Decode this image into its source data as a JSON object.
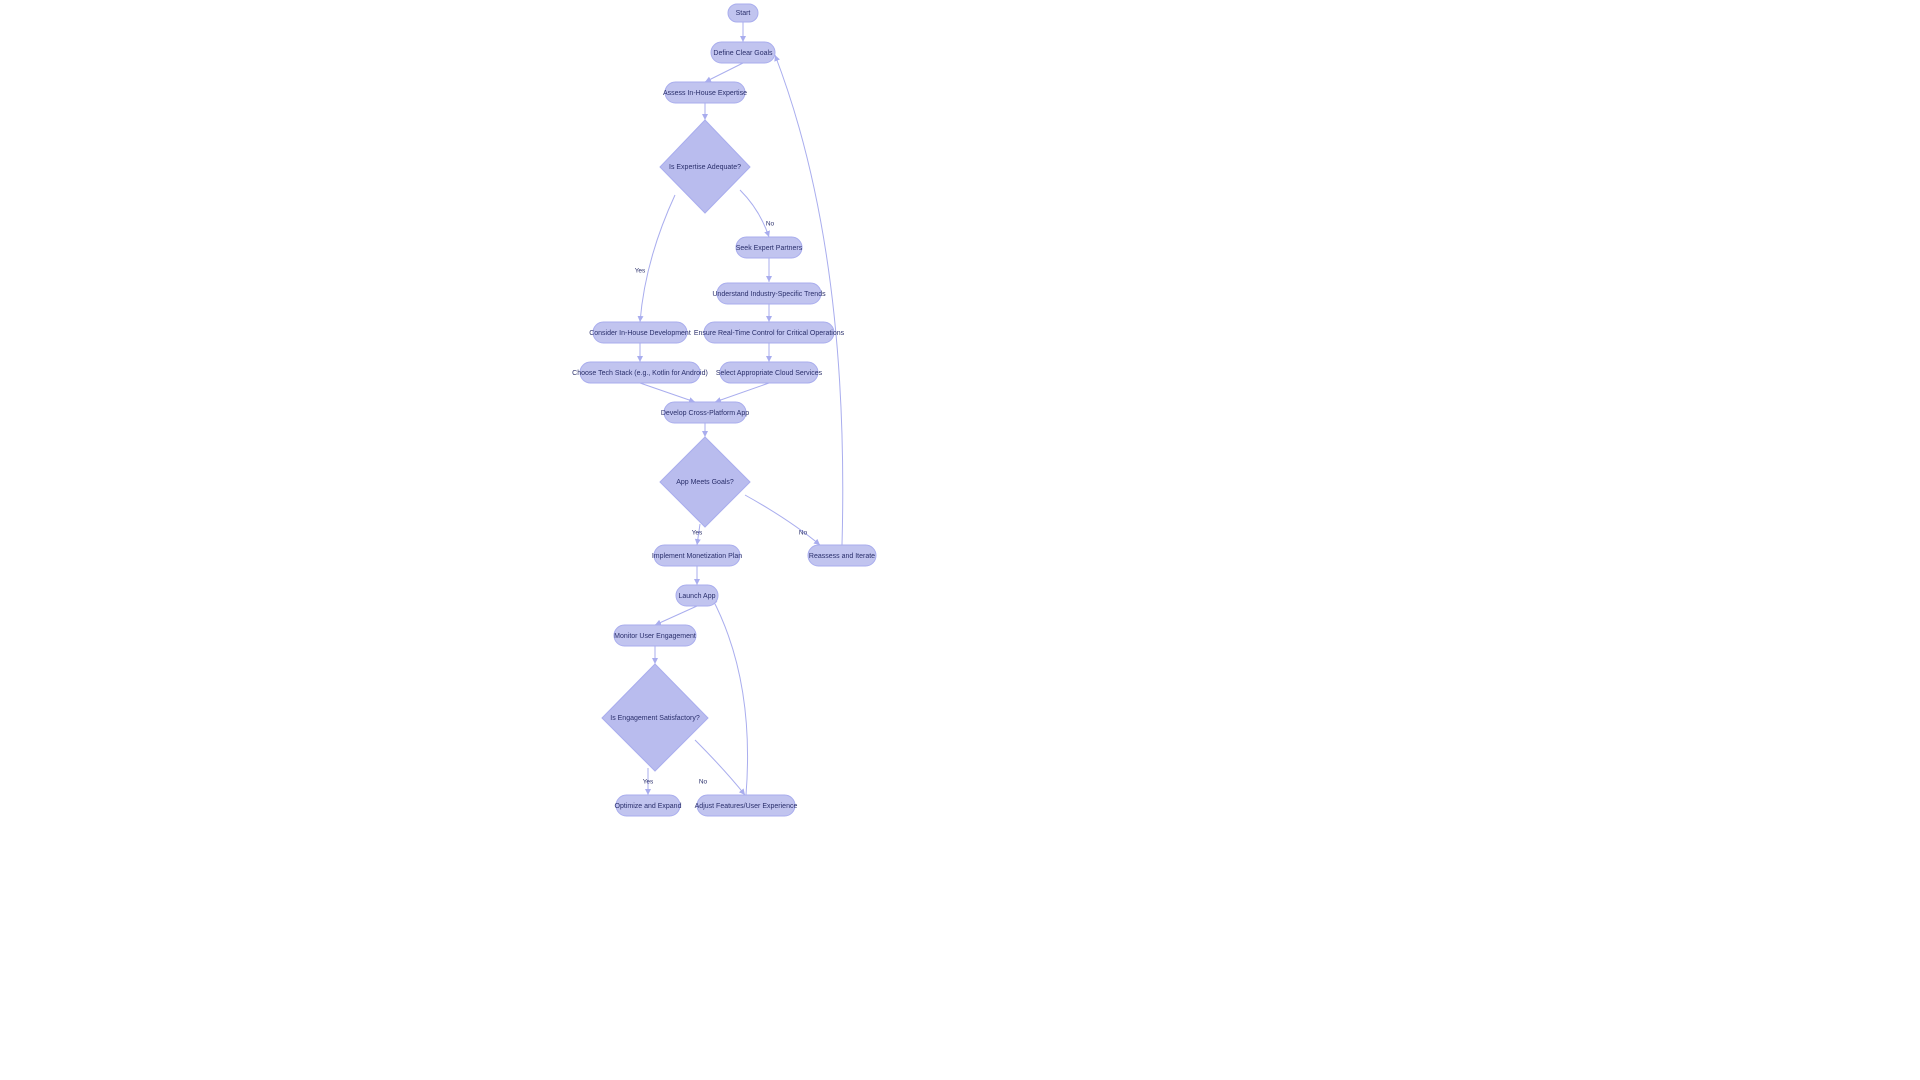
{
  "diagram": {
    "type": "flowchart",
    "colors": {
      "node_fill": "#c1c4ef",
      "node_stroke": "#a9adee",
      "diamond_fill": "#b9bcee",
      "text": "#2a2f6b",
      "edge": "#a9adee",
      "background": "#ffffff"
    },
    "nodes": {
      "start": {
        "label": "Start",
        "shape": "pill"
      },
      "define_goals": {
        "label": "Define Clear Goals",
        "shape": "pill"
      },
      "assess_expertise": {
        "label": "Assess In-House Expertise",
        "shape": "pill"
      },
      "expertise_adequate": {
        "label": "Is Expertise Adequate?",
        "shape": "diamond"
      },
      "seek_partners": {
        "label": "Seek Expert Partners",
        "shape": "pill"
      },
      "understand_trends": {
        "label": "Understand Industry-Specific Trends",
        "shape": "pill"
      },
      "ensure_realtime": {
        "label": "Ensure Real-Time Control for Critical Operations",
        "shape": "pill"
      },
      "select_cloud": {
        "label": "Select Appropriate Cloud Services",
        "shape": "pill"
      },
      "consider_inhouse": {
        "label": "Consider In-House Development",
        "shape": "pill"
      },
      "choose_tech": {
        "label": "Choose Tech Stack (e.g., Kotlin for Android)",
        "shape": "pill"
      },
      "develop_app": {
        "label": "Develop Cross-Platform App",
        "shape": "pill"
      },
      "app_meets_goals": {
        "label": "App Meets Goals?",
        "shape": "diamond"
      },
      "monetization": {
        "label": "Implement Monetization Plan",
        "shape": "pill"
      },
      "reassess": {
        "label": "Reassess and Iterate",
        "shape": "pill"
      },
      "launch": {
        "label": "Launch App",
        "shape": "pill"
      },
      "monitor": {
        "label": "Monitor User Engagement",
        "shape": "pill"
      },
      "engagement_ok": {
        "label": "Is Engagement Satisfactory?",
        "shape": "diamond"
      },
      "optimize": {
        "label": "Optimize and Expand",
        "shape": "pill"
      },
      "adjust_features": {
        "label": "Adjust Features/User Experience",
        "shape": "pill"
      }
    },
    "edges": [
      {
        "from": "start",
        "to": "define_goals",
        "label": ""
      },
      {
        "from": "define_goals",
        "to": "assess_expertise",
        "label": ""
      },
      {
        "from": "assess_expertise",
        "to": "expertise_adequate",
        "label": ""
      },
      {
        "from": "expertise_adequate",
        "to": "seek_partners",
        "label": "No"
      },
      {
        "from": "expertise_adequate",
        "to": "consider_inhouse",
        "label": "Yes"
      },
      {
        "from": "seek_partners",
        "to": "understand_trends",
        "label": ""
      },
      {
        "from": "understand_trends",
        "to": "ensure_realtime",
        "label": ""
      },
      {
        "from": "ensure_realtime",
        "to": "select_cloud",
        "label": ""
      },
      {
        "from": "consider_inhouse",
        "to": "choose_tech",
        "label": ""
      },
      {
        "from": "choose_tech",
        "to": "develop_app",
        "label": ""
      },
      {
        "from": "select_cloud",
        "to": "develop_app",
        "label": ""
      },
      {
        "from": "develop_app",
        "to": "app_meets_goals",
        "label": ""
      },
      {
        "from": "app_meets_goals",
        "to": "monetization",
        "label": "Yes"
      },
      {
        "from": "app_meets_goals",
        "to": "reassess",
        "label": "No"
      },
      {
        "from": "reassess",
        "to": "define_goals",
        "label": ""
      },
      {
        "from": "monetization",
        "to": "launch",
        "label": ""
      },
      {
        "from": "launch",
        "to": "monitor",
        "label": ""
      },
      {
        "from": "monitor",
        "to": "engagement_ok",
        "label": ""
      },
      {
        "from": "engagement_ok",
        "to": "optimize",
        "label": "Yes"
      },
      {
        "from": "engagement_ok",
        "to": "adjust_features",
        "label": "No"
      },
      {
        "from": "adjust_features",
        "to": "launch",
        "label": ""
      }
    ],
    "edge_labels": {
      "exp_no": "No",
      "exp_yes": "Yes",
      "goals_yes": "Yes",
      "goals_no": "No",
      "eng_yes": "Yes",
      "eng_no": "No"
    }
  }
}
